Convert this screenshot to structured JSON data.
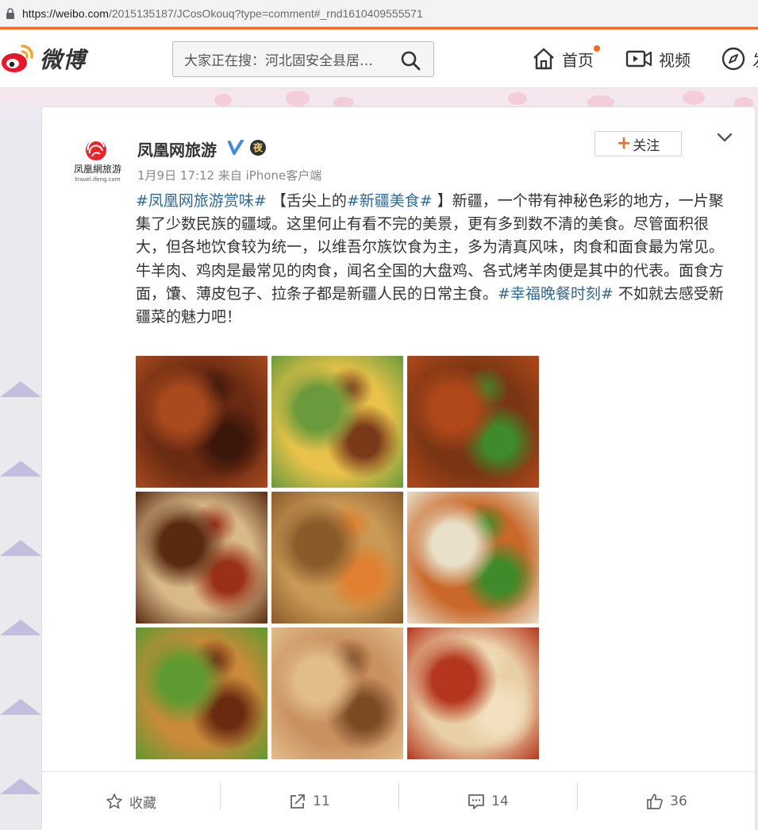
{
  "browser": {
    "url_host": "https://weibo.com",
    "url_path": "/2015135187/JCosOkouq?type=comment#_rnd1610409555571"
  },
  "header": {
    "logo_text": "微博",
    "search_placeholder": "大家正在搜：河北固安全县居…",
    "nav": {
      "home": "首页",
      "video": "视频",
      "discover": "发"
    }
  },
  "post": {
    "avatar_caption": "凤凰網旅游",
    "avatar_subcaption": "travel.ifeng.com",
    "user_name": "凤凰网旅游",
    "night_badge": "夜",
    "meta": "1月9日 17:12 来自 iPhone客户端",
    "follow_label": "关注",
    "text": {
      "topic1": "#凤凰网旅游赏味#",
      "part1": " 【舌尖上的",
      "topic2": "#新疆美食#",
      "part2": " 】新疆，一个带有神秘色彩的地方，一片聚集了少数民族的疆域。这里何止有看不完的美景，更有多到数不清的美食。尽管面积很大，但各地饮食较为统一，以维吾尔族饮食为主，多为清真风味，肉食和面食最为常见。牛羊肉、鸡肉是最常见的肉食，闻名全国的大盘鸡、各式烤羊肉便是其中的代表。面食方面，馕、薄皮包子、拉条子都是新疆人民的日常主食。",
      "topic3": "#幸福晚餐时刻#",
      "part3": " 不如就去感受新疆菜的魅力吧！"
    },
    "images": [
      {
        "name": "lamb-skewers",
        "colors": [
          "#6b2a12",
          "#a84a1e",
          "#3b160a"
        ]
      },
      {
        "name": "noodles-cucumber",
        "colors": [
          "#e8c24a",
          "#6a9a3c",
          "#7a3a1a"
        ]
      },
      {
        "name": "dapanji-chicken",
        "colors": [
          "#7a3514",
          "#b0481a",
          "#3f8a2a"
        ]
      },
      {
        "name": "stir-fried-chicken",
        "colors": [
          "#d9b98a",
          "#5a2a10",
          "#9a3018"
        ]
      },
      {
        "name": "pilaf-rice",
        "colors": [
          "#c99a56",
          "#8a5a2a",
          "#e08030"
        ]
      },
      {
        "name": "noodle-soup",
        "colors": [
          "#c9682a",
          "#e8e0c8",
          "#3f8a2a"
        ]
      },
      {
        "name": "laghman-noodles",
        "colors": [
          "#c98a3a",
          "#5f9a30",
          "#6a2a10"
        ]
      },
      {
        "name": "nang-bread",
        "colors": [
          "#c99060",
          "#e2bd8a",
          "#7a4a25"
        ]
      },
      {
        "name": "samsa-dumplings",
        "colors": [
          "#e9cfa5",
          "#b5361e",
          "#f2e0c0"
        ]
      }
    ],
    "actions": {
      "favorite": "收藏",
      "repost": "11",
      "comment": "14",
      "like": "36"
    }
  }
}
